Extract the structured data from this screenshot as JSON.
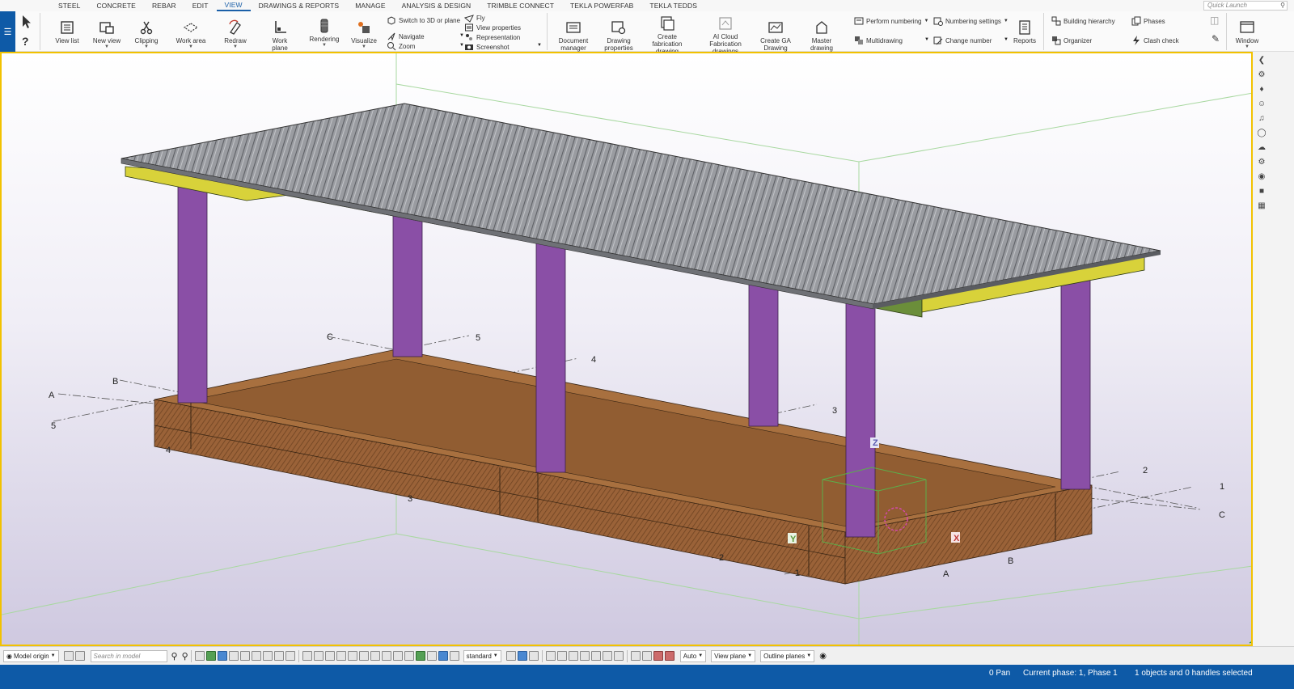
{
  "menu": {
    "tabs": [
      "STEEL",
      "CONCRETE",
      "REBAR",
      "EDIT",
      "VIEW",
      "DRAWINGS & REPORTS",
      "MANAGE",
      "ANALYSIS & DESIGN",
      "TRIMBLE CONNECT",
      "TEKLA POWERFAB",
      "TEKLA TEDDS"
    ],
    "active_tab": "VIEW",
    "quick_launch_placeholder": "Quick Launch"
  },
  "ribbon": {
    "view_list": "View list",
    "new_view": "New view",
    "clipping": "Clipping",
    "work_area": "Work area",
    "redraw": "Redraw",
    "work_plane": "Work plane",
    "rendering": "Rendering",
    "visualize": "Visualize",
    "switch_3d": "Switch to 3D or plane",
    "navigate": "Navigate",
    "zoom": "Zoom",
    "fly": "Fly",
    "view_properties": "View properties",
    "representation": "Representation",
    "screenshot": "Screenshot",
    "document_manager": "Document manager",
    "drawing_properties": "Drawing properties",
    "create_fabrication_drawing": "Create fabrication drawing",
    "ai_cloud_fabrication": "AI Cloud Fabrication drawings",
    "create_ga_drawing": "Create GA Drawing",
    "master_drawing_catalog": "Master drawing catalog",
    "perform_numbering": "Perform numbering",
    "multidrawing": "Multidrawing",
    "numbering_settings": "Numbering settings",
    "change_number": "Change number",
    "reports": "Reports",
    "building_hierarchy": "Building hierarchy",
    "organizer": "Organizer",
    "phases": "Phases",
    "clash_check": "Clash check",
    "window": "Window"
  },
  "viewport": {
    "grid_labels": {
      "A_left": "A",
      "B_left": "B",
      "C_left": "C",
      "five_left": "5",
      "four_left": "4",
      "three_left": "3",
      "five_top": "5",
      "four_top": "4",
      "three_mid": "3",
      "two_right": "2",
      "one_right": "1",
      "C_right": "C",
      "two_bottom": "2",
      "one_bottom": "1",
      "A_bottom": "A",
      "B_bottom": "B"
    },
    "axis_z": "Z",
    "axis_y": "Y",
    "axis_x": "X"
  },
  "colors": {
    "column": "#8a4fa6",
    "beam_green": "#6b8e3a",
    "beam_yellow": "#d8d23a",
    "slab": "#a06a40",
    "roof": "#8d8f94",
    "ribbon_accent": "#0e5aa7",
    "viewport_border": "#f2c200"
  },
  "bottom_bar": {
    "model_origin": "Model origin",
    "search_placeholder": "Search in model",
    "standard": "standard",
    "auto": "Auto",
    "view_plane": "View plane",
    "outline_planes": "Outline planes"
  },
  "status": {
    "pan": "0 Pan",
    "phase": "Current phase: 1, Phase 1",
    "selection": "1 objects and 0 handles selected"
  }
}
